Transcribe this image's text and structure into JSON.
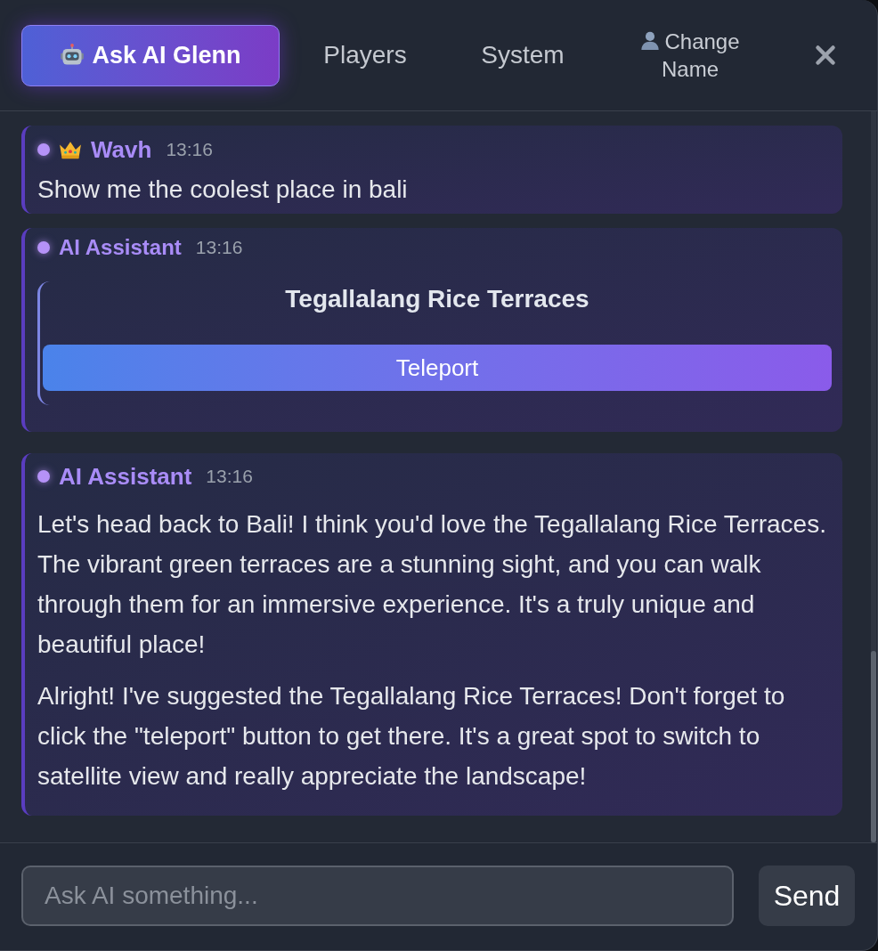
{
  "tabs": [
    {
      "label": "Ask AI Glenn",
      "selected": true
    },
    {
      "label": "Players",
      "selected": false
    },
    {
      "label": "System",
      "selected": false
    },
    {
      "label": "Change Name",
      "selected": false
    }
  ],
  "messages": [
    {
      "kind": "user",
      "author": "Wavh",
      "time": "13:16",
      "paragraphs": [
        "Show me the coolest place in bali"
      ]
    },
    {
      "kind": "place",
      "author": "AI Assistant",
      "time": "13:16",
      "place": {
        "title": "Tegallalang Rice Terraces",
        "action": "Teleport"
      }
    },
    {
      "kind": "reply",
      "author": "AI Assistant",
      "time": "13:16",
      "paragraphs": [
        "Let's head back to Bali! I think you'd love the Tegallalang Rice Terraces. The vibrant green terraces are a stunning sight, and you can walk through them for an immersive experience. It's a truly unique and beautiful place!",
        "Alright! I've suggested the Tegallalang Rice Terraces! Don't forget to click the \"teleport\" button to get there. It's a great spot to switch to satellite view and really appreciate the landscape!"
      ]
    }
  ],
  "composer": {
    "placeholder": "Ask AI something...",
    "send": "Send"
  }
}
